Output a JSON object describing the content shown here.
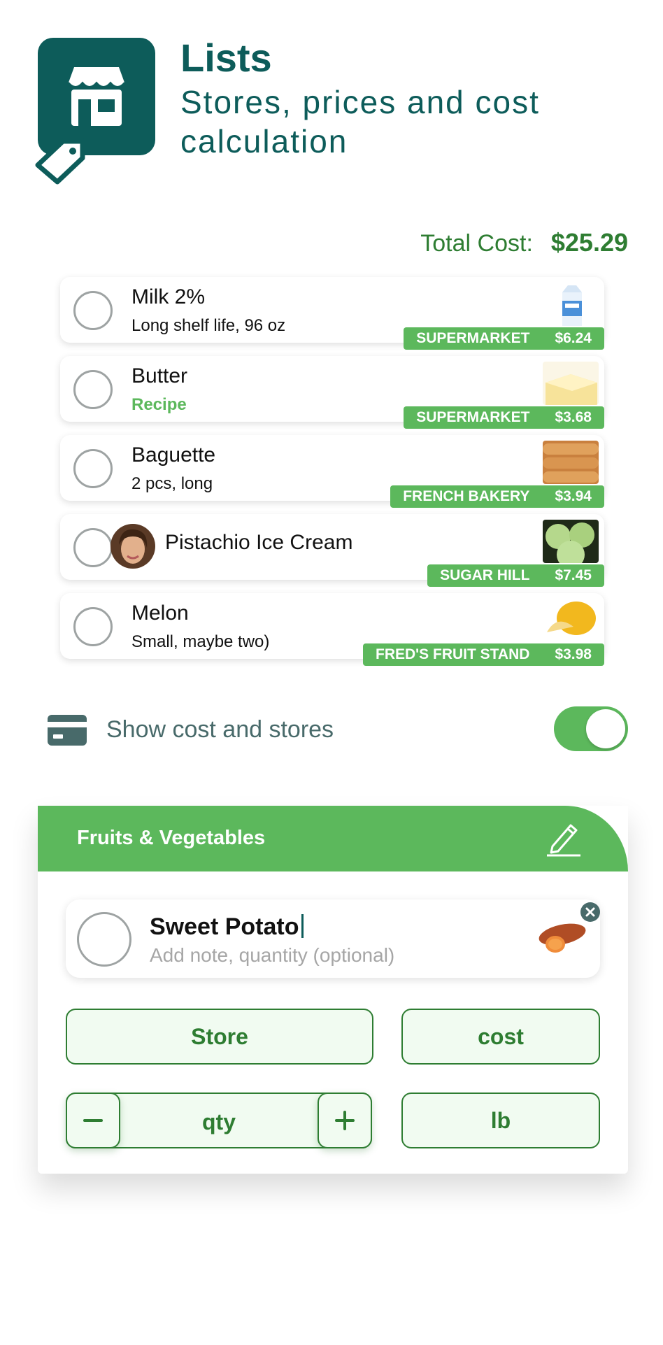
{
  "header": {
    "title": "Lists",
    "subtitle": "Stores, prices and cost calculation"
  },
  "total": {
    "label": "Total Cost:",
    "value": "$25.29"
  },
  "items": [
    {
      "name": "Milk 2%",
      "note": "Long shelf life, 96 oz",
      "store": "SUPERMARKET",
      "price": "$6.24",
      "image": "milk-carton"
    },
    {
      "name": "Butter",
      "note": "Recipe",
      "store": "SUPERMARKET",
      "price": "$3.68",
      "image": "butter"
    },
    {
      "name": "Baguette",
      "note": "2 pcs, long",
      "store": "FRENCH BAKERY",
      "price": "$3.94",
      "image": "baguette"
    },
    {
      "name": "Pistachio Ice Cream",
      "note": "",
      "store": "SUGAR HILL",
      "price": "$7.45",
      "image": "cabbage",
      "assignee": "avatar"
    },
    {
      "name": "Melon",
      "note": "Small, maybe two)",
      "store": "FRED'S FRUIT STAND",
      "price": "$3.98",
      "image": "melon"
    }
  ],
  "settings": {
    "show_cost_label": "Show cost and stores",
    "show_cost_enabled": true
  },
  "category": {
    "title": "Fruits & Vegetables",
    "new_item": {
      "name": "Sweet Potato",
      "placeholder": "Add note, quantity (optional)",
      "image": "sweet-potato"
    },
    "store_button": "Store",
    "cost_button": "cost",
    "qty_label": "qty",
    "unit_button": "lb"
  },
  "colors": {
    "brand": "#0d5c5a",
    "accent": "#5cb85c",
    "dark_green": "#2e7d32"
  }
}
